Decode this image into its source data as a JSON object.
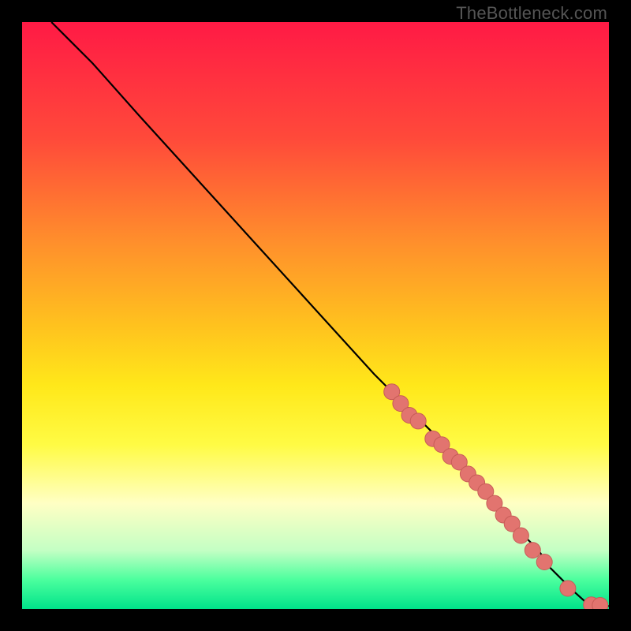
{
  "watermark": "TheBottleneck.com",
  "colors": {
    "dot_fill": "#e2746f",
    "dot_stroke": "#c75c57",
    "line": "#000000"
  },
  "chart_data": {
    "type": "line",
    "title": "",
    "xlabel": "",
    "ylabel": "",
    "xlim": [
      0,
      100
    ],
    "ylim": [
      0,
      100
    ],
    "grid": false,
    "legend": false,
    "series": [
      {
        "name": "curve",
        "kind": "line",
        "x": [
          5,
          8,
          12,
          20,
          30,
          40,
          50,
          60,
          65,
          70,
          75,
          80,
          85,
          88,
          90,
          92,
          94,
          96,
          98,
          100
        ],
        "y": [
          100,
          97,
          93,
          84,
          73,
          62,
          51,
          40,
          35,
          30,
          24,
          19,
          13,
          10,
          7,
          5,
          3,
          1.2,
          0.5,
          0.5
        ]
      },
      {
        "name": "points",
        "kind": "scatter",
        "x": [
          63,
          64.5,
          66,
          67.5,
          70,
          71.5,
          73,
          74.5,
          76,
          77.5,
          79,
          80.5,
          82,
          83.5,
          85,
          87,
          89,
          93,
          97,
          98.5
        ],
        "y": [
          37,
          35,
          33,
          32,
          29,
          28,
          26,
          25,
          23,
          21.5,
          20,
          18,
          16,
          14.5,
          12.5,
          10,
          8,
          3.5,
          0.7,
          0.6
        ]
      }
    ]
  }
}
